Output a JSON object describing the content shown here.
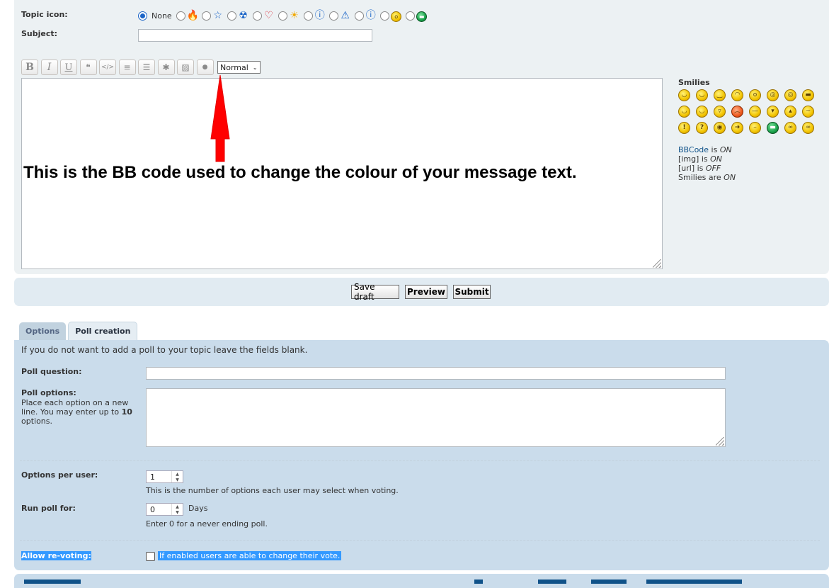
{
  "topic_icon": {
    "label": "Topic icon:",
    "none_label": "None",
    "icons": [
      "fire-icon",
      "star-icon",
      "radioactive-icon",
      "heart-icon",
      "sun-icon",
      "question-icon",
      "warning-icon",
      "info-icon",
      "surprised-smiley-icon",
      "grin-smiley-icon"
    ]
  },
  "subject": {
    "label": "Subject:",
    "value": ""
  },
  "toolbar": {
    "buttons": [
      {
        "name": "bold-button",
        "glyph": "B"
      },
      {
        "name": "italic-button",
        "glyph": "I"
      },
      {
        "name": "underline-button",
        "glyph": "U"
      },
      {
        "name": "quote-button",
        "glyph": "❝"
      },
      {
        "name": "code-button",
        "glyph": "</>"
      },
      {
        "name": "list-button",
        "glyph": "≡"
      },
      {
        "name": "ordered-list-button",
        "glyph": "☰"
      },
      {
        "name": "list-item-button",
        "glyph": "✱"
      },
      {
        "name": "image-button",
        "glyph": "▨"
      },
      {
        "name": "colour-button",
        "glyph": "●"
      }
    ],
    "font_size": "Normal"
  },
  "annotation": {
    "text": "This is the BB code used to change the colour of your message text.",
    "arrow_color": "#ff0000"
  },
  "smilies": {
    "title": "Smilies",
    "rows": [
      [
        "😄",
        "😀",
        "😉",
        "😊",
        "😲",
        "😵",
        "😯",
        "😎"
      ],
      [
        "😁",
        "😆",
        "😛",
        "😡",
        "😒",
        "😈",
        "😬",
        "😕"
      ],
      [
        "!",
        "?",
        "💡",
        "➜",
        "😐",
        "😁",
        "🤓",
        "🤓"
      ]
    ]
  },
  "bbcode_status": {
    "bbcode_link": "BBCode",
    "bbcode_is": " is ",
    "bbcode_state": "ON",
    "img_label": "[img] is ",
    "img_state": "ON",
    "url_label": "[url] is ",
    "url_state": "OFF",
    "smilies_label": "Smilies are ",
    "smilies_state": "ON"
  },
  "actions": {
    "save_draft": "Save draft",
    "preview": "Preview",
    "submit": "Submit"
  },
  "tabs": [
    {
      "label": "Options",
      "active": false
    },
    {
      "label": "Poll creation",
      "active": true
    }
  ],
  "poll": {
    "intro": "If you do not want to add a poll to your topic leave the fields blank.",
    "question_label": "Poll question:",
    "options_label": "Poll options:",
    "options_hint_pre": "Place each option on a new line. You may enter up to ",
    "options_hint_max": "10",
    "options_hint_post": " options.",
    "per_user_label": "Options per user:",
    "per_user_value": "1",
    "per_user_hint": "This is the number of options each user may select when voting.",
    "run_label": "Run poll for:",
    "run_value": "0",
    "run_unit": "Days",
    "run_hint": "Enter 0 for a never ending poll.",
    "revote_label": "Allow re-voting:",
    "revote_hint": "If enabled users are able to change their vote."
  }
}
